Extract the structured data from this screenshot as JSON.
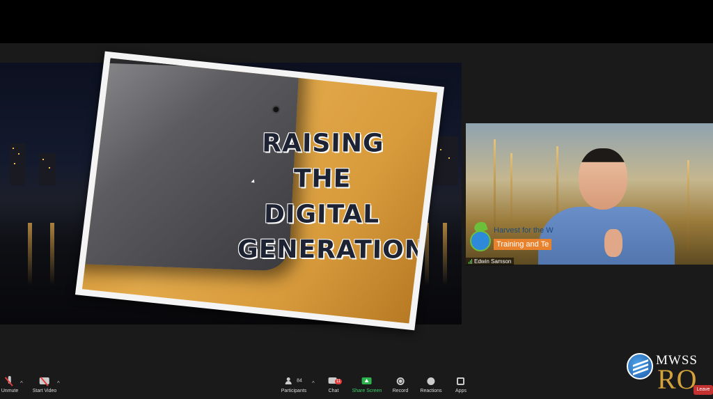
{
  "shared_screen": {
    "slide_title_lines": [
      "RAISING",
      "THE",
      "DIGITAL",
      "GENERATION"
    ]
  },
  "video_tile": {
    "participant_name": "Edwin Samson",
    "banner_line1": "Harvest for the W",
    "banner_line2": "Training and Te",
    "logo_text": "Harvest for the World"
  },
  "toolbar": {
    "unmute_label": "Unmute",
    "start_video_label": "Start Video",
    "participants_label": "Participants",
    "participants_count": "84",
    "chat_label": "Chat",
    "chat_badge": "11",
    "share_screen_label": "Share Screen",
    "record_label": "Record",
    "reactions_label": "Reactions",
    "apps_label": "Apps",
    "leave_label": "Leave",
    "caret": "^"
  },
  "watermark": {
    "line1": "MWSS",
    "line2": "RO"
  },
  "colors": {
    "accent_share": "#2bb24c",
    "leave_red": "#c43131",
    "logo_gold": "#d3a23a",
    "logo_blue": "#1a5aa8"
  }
}
